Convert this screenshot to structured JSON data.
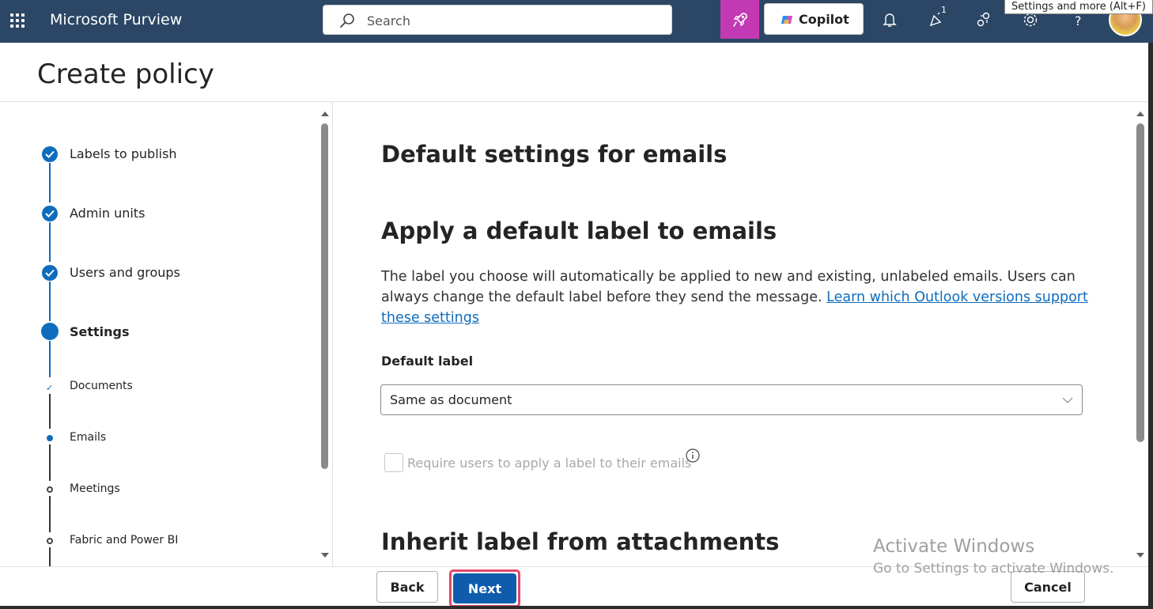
{
  "topbar": {
    "app_title": "Microsoft Purview",
    "search_placeholder": "Search",
    "copilot_label": "Copilot",
    "notification_badge": "1",
    "tooltip": "Settings and more (Alt+F)",
    "icons": [
      "app-launcher-icon",
      "search-icon",
      "rocket-icon",
      "copilot-icon",
      "bell-icon",
      "whats-new-icon",
      "share-icon",
      "gear-icon",
      "help-icon"
    ]
  },
  "header": {
    "title": "Create policy"
  },
  "steps": {
    "items": [
      {
        "label": "Labels to publish",
        "state": "done"
      },
      {
        "label": "Admin units",
        "state": "done"
      },
      {
        "label": "Users and groups",
        "state": "done"
      },
      {
        "label": "Settings",
        "state": "current"
      }
    ],
    "sub_items": [
      {
        "label": "Documents",
        "state": "done"
      },
      {
        "label": "Emails",
        "state": "current"
      },
      {
        "label": "Meetings",
        "state": "pending"
      },
      {
        "label": "Fabric and Power BI",
        "state": "pending"
      }
    ]
  },
  "main": {
    "title": "Default settings for emails",
    "section_title": "Apply a default label to emails",
    "description": "The label you choose will automatically be applied to new and existing, unlabeled emails. Users can always change the default label before they send the message.",
    "description_link": "Learn which Outlook versions support these settings",
    "field_label": "Default label",
    "select_value": "Same as document",
    "checkbox_label": "Require users to apply a label to their emails",
    "checkbox_checked": false,
    "checkbox_disabled": true,
    "section2_title": "Inherit label from attachments"
  },
  "watermark": {
    "line1": "Activate Windows",
    "line2": "Go to Settings to activate Windows."
  },
  "footer": {
    "back_label": "Back",
    "next_label": "Next",
    "cancel_label": "Cancel"
  },
  "colors": {
    "topbar": "#2b4765",
    "accent": "#0f6cbd",
    "primary_button": "#0f5cad",
    "rocket_button": "#c239b3",
    "highlight_outline": "#e0486b"
  }
}
